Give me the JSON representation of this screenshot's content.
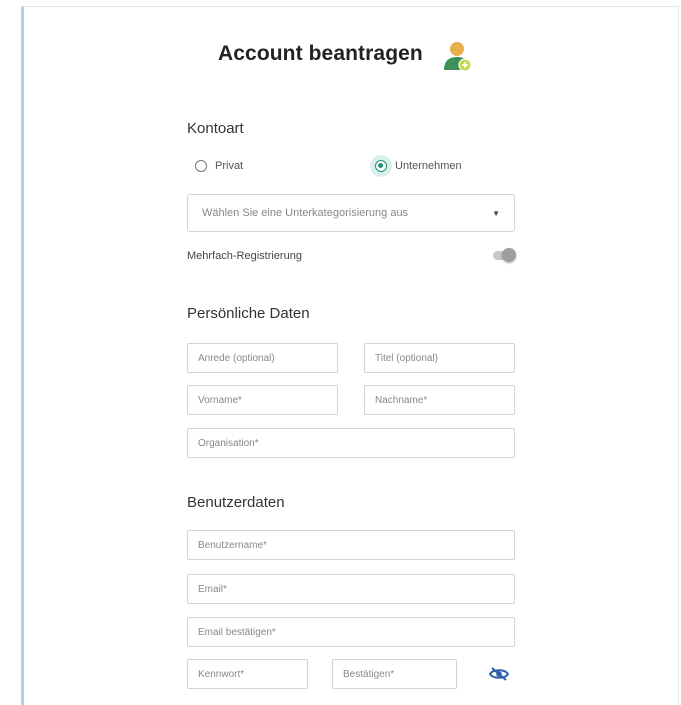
{
  "header": {
    "title": "Account beantragen",
    "avatar_icon": "user-add-icon"
  },
  "account_type": {
    "heading": "Kontoart",
    "options": [
      {
        "label": "Privat",
        "selected": false
      },
      {
        "label": "Unternehmen",
        "selected": true
      }
    ],
    "subcategory_select": {
      "value": "Wählen Sie eine Unterkategorisierung aus",
      "caret_icon": "caret-down-icon"
    },
    "multi_registration": {
      "label": "Mehrfach-Registrierung",
      "enabled": false
    }
  },
  "personal": {
    "heading": "Persönliche Daten",
    "salutation_placeholder": "Anrede (optional)",
    "title_placeholder": "Titel (optional)",
    "firstname_placeholder": "Vorname*",
    "lastname_placeholder": "Nachname*",
    "organization_placeholder": "Organisation*"
  },
  "user": {
    "heading": "Benutzerdaten",
    "username_placeholder": "Benutzername*",
    "email_placeholder": "Email*",
    "email_confirm_placeholder": "Email bestätigen*",
    "password_placeholder": "Kennwort*",
    "password_confirm_placeholder": "Bestätigen*",
    "visibility_icon": "eye-hidden-icon"
  },
  "colors": {
    "accent": "#2a8f7a",
    "eye": "#2f5fa8"
  }
}
